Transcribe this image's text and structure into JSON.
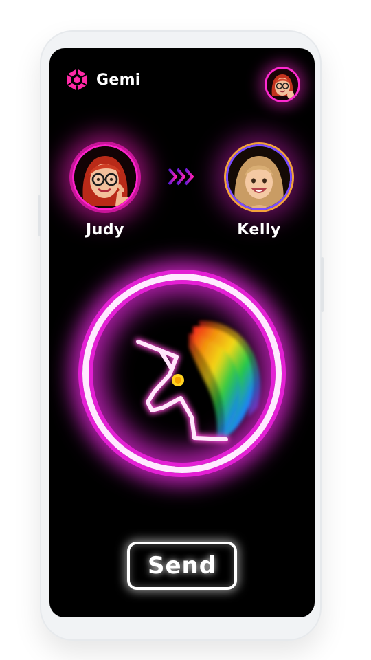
{
  "app": {
    "name": "Gemi",
    "logo_icon": "cube-hex-icon"
  },
  "header": {
    "profile_icon": "avatar-memoji-red-hair"
  },
  "transfer": {
    "sender": {
      "name": "Judy",
      "avatar": "memoji-red-hair-glasses-thumbs-up"
    },
    "arrow_icon": "triple-chevron-right-icon",
    "receiver": {
      "name": "Kelly",
      "avatar": "memoji-blonde-smiling"
    }
  },
  "gift": {
    "icon": "neon-unicorn-rainbow-mane-icon"
  },
  "actions": {
    "send_label": "Send"
  },
  "colors": {
    "background": "#000000",
    "neon_pink": "#e420d4",
    "hot_pink": "#ff22cc",
    "text": "#ffffff",
    "device_frame": "#f1f3f5"
  }
}
